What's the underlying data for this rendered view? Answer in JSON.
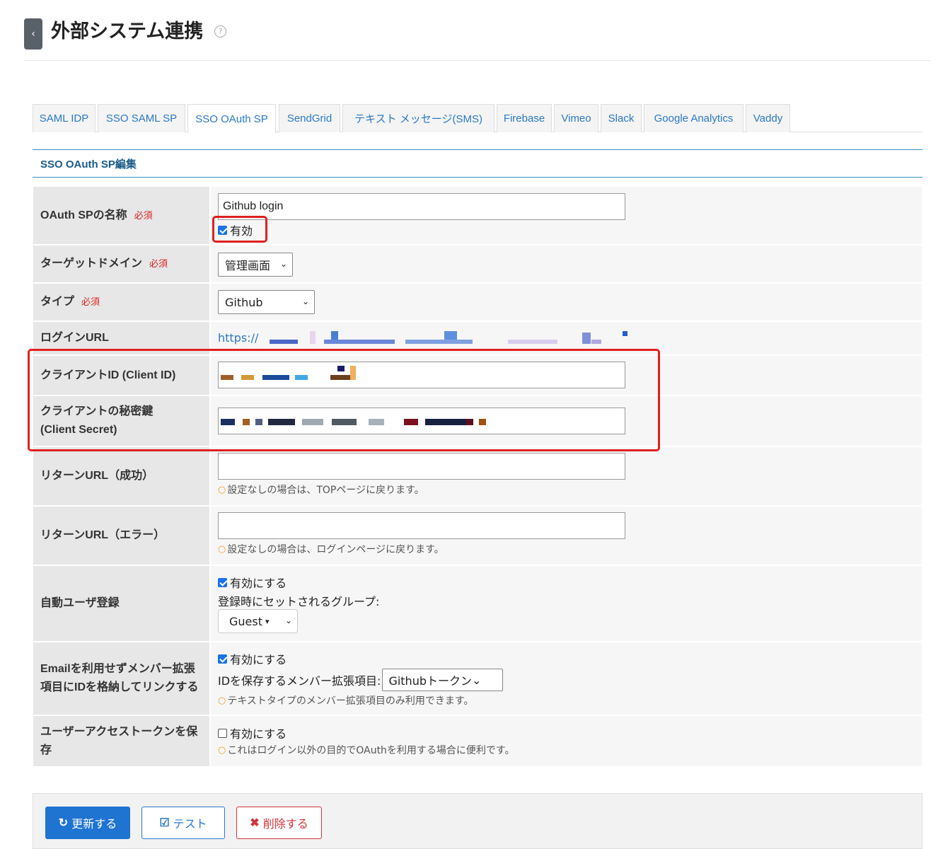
{
  "header": {
    "title": "外部システム連携",
    "back_icon": "‹",
    "help_icon": "?"
  },
  "tabs": [
    {
      "label": "SAML IDP"
    },
    {
      "label": "SSO SAML SP"
    },
    {
      "label": "SSO OAuth SP"
    },
    {
      "label": "SendGrid"
    },
    {
      "label": "テキスト メッセージ(SMS)"
    },
    {
      "label": "Firebase"
    },
    {
      "label": "Vimeo"
    },
    {
      "label": "Slack"
    },
    {
      "label": "Google Analytics"
    },
    {
      "label": "Vaddy"
    }
  ],
  "active_tab": "SSO OAuth SP",
  "section_title": "SSO OAuth SP編集",
  "required_label": "必須",
  "form": {
    "name": {
      "label": "OAuth SPの名称",
      "value": "Github login",
      "enabled_label": "有効",
      "enabled": true
    },
    "target_domain": {
      "label": "ターゲットドメイン",
      "value": "管理画面"
    },
    "type": {
      "label": "タイプ",
      "value": "Github"
    },
    "login_url": {
      "label": "ログインURL",
      "value": "https://"
    },
    "client_id": {
      "label": "クライアントID (Client ID)"
    },
    "client_secret": {
      "label1": "クライアントの秘密鍵",
      "label2": "(Client Secret)"
    },
    "return_success": {
      "label": "リターンURL（成功）",
      "value": "",
      "hint": "設定なしの場合は、TOPページに戻ります。"
    },
    "return_error": {
      "label": "リターンURL（エラー）",
      "value": "",
      "hint": "設定なしの場合は、ログインページに戻ります。"
    },
    "auto_register": {
      "label": "自動ユーザ登録",
      "enable_label": "有効にする",
      "enabled": true,
      "group_label": "登録時にセットされるグループ:",
      "group_value": "Guest"
    },
    "email_link": {
      "label": "Emailを利用せずメンバー拡張項目にIDを格納してリンクする",
      "enable_label": "有効にする",
      "enabled": true,
      "field_label": "IDを保存するメンバー拡張項目:",
      "field_value": "Githubトークン",
      "hint": "テキストタイプのメンバー拡張項目のみ利用できます。"
    },
    "save_token": {
      "label": "ユーザーアクセストークンを保存",
      "enable_label": "有効にする",
      "enabled": false,
      "hint": "これはログイン以外の目的でOAuthを利用する場合に便利です。"
    }
  },
  "buttons": {
    "update": "更新する",
    "test": "テスト",
    "delete": "削除する"
  },
  "colors": {
    "primary": "#1f73d1",
    "link": "#2b79c4",
    "danger": "#d0353b",
    "highlight": "#e02020"
  }
}
